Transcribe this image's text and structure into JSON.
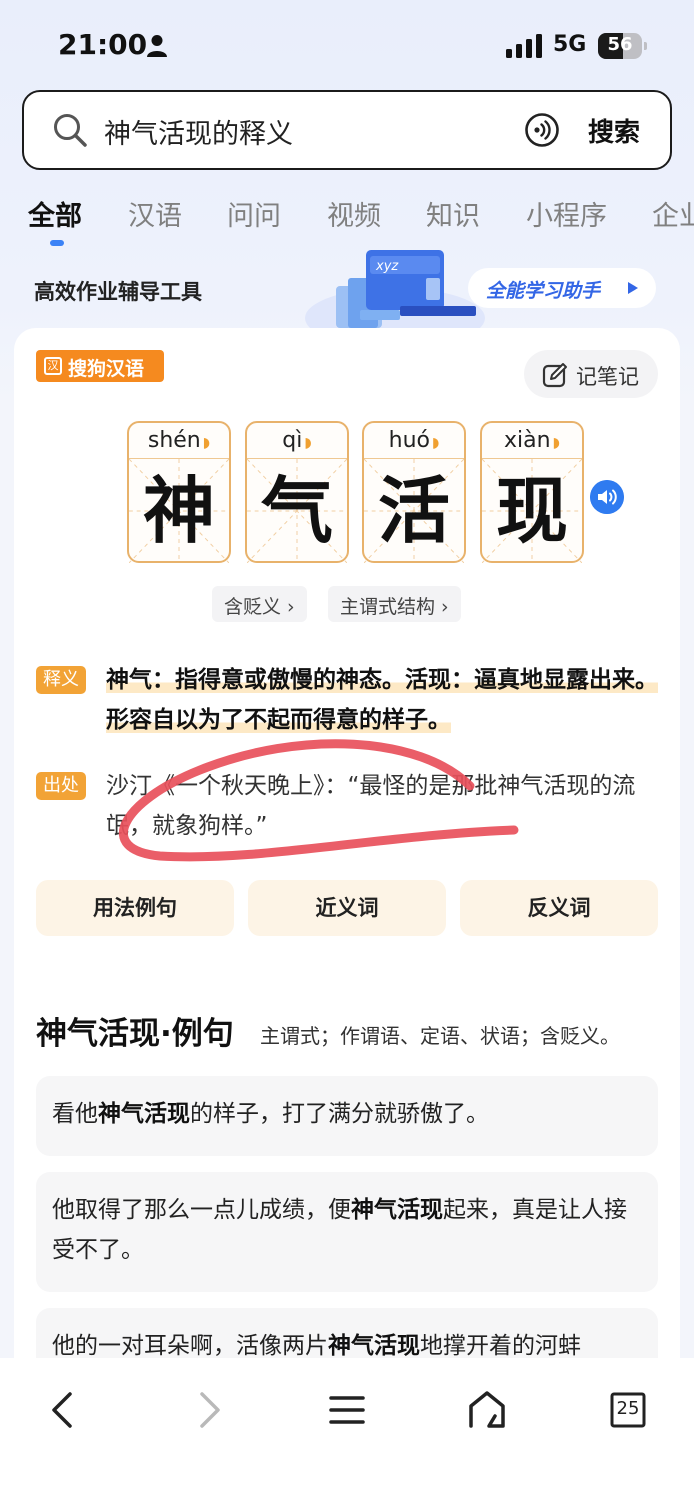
{
  "status_bar": {
    "time": "21:00",
    "network": "5G",
    "battery_level": "56"
  },
  "search": {
    "query": "神气活现的释义",
    "button_label": "搜索"
  },
  "tabs": [
    "全部",
    "汉语",
    "问问",
    "视频",
    "知识",
    "小程序",
    "企业"
  ],
  "promo": {
    "text": "高效作业辅导工具",
    "art_text": "xyz",
    "pill_label": "全能学习助手"
  },
  "card": {
    "brand": "搜狗汉语",
    "brand_icon_char": "汉",
    "note_button": "记笔记",
    "characters": [
      {
        "pinyin": "shén",
        "hanzi": "神"
      },
      {
        "pinyin": "qì",
        "hanzi": "气"
      },
      {
        "pinyin": "huó",
        "hanzi": "活"
      },
      {
        "pinyin": "xiàn",
        "hanzi": "现"
      }
    ],
    "tags": [
      "含贬义 ›",
      "主谓式结构 ›"
    ],
    "definition_label": "释义",
    "definition": "神气：指得意或傲慢的神态。活现：逼真地显露出来。形容自以为了不起而得意的样子。",
    "source_label": "出处",
    "source": "沙汀《一个秋天晚上》：“最怪的是那批神气活现的流氓，就象狗样。”",
    "quick_buttons": [
      "用法例句",
      "近义词",
      "反义词"
    ],
    "examples_title": "神气活现·例句",
    "examples_subtitle": "主谓式；作谓语、定语、状语；含贬义。",
    "examples": [
      {
        "before": "看他",
        "keyword": "神气活现",
        "after": "的样子，打了满分就骄傲了。"
      },
      {
        "before": "他取得了那么一点儿成绩，便",
        "keyword": "神气活现",
        "after": "起来，真是让人接受不了。"
      },
      {
        "before": "他的一对耳朵啊，活像两片",
        "keyword": "神气活现",
        "after": "地撑开着的河蚌"
      }
    ]
  },
  "bottom_nav": {
    "tab_count": "25"
  },
  "colors": {
    "accent_blue": "#3b82f6",
    "brand_orange": "#f58a1f",
    "char_border": "#e8b26b",
    "scribble_red": "#e8505b"
  }
}
